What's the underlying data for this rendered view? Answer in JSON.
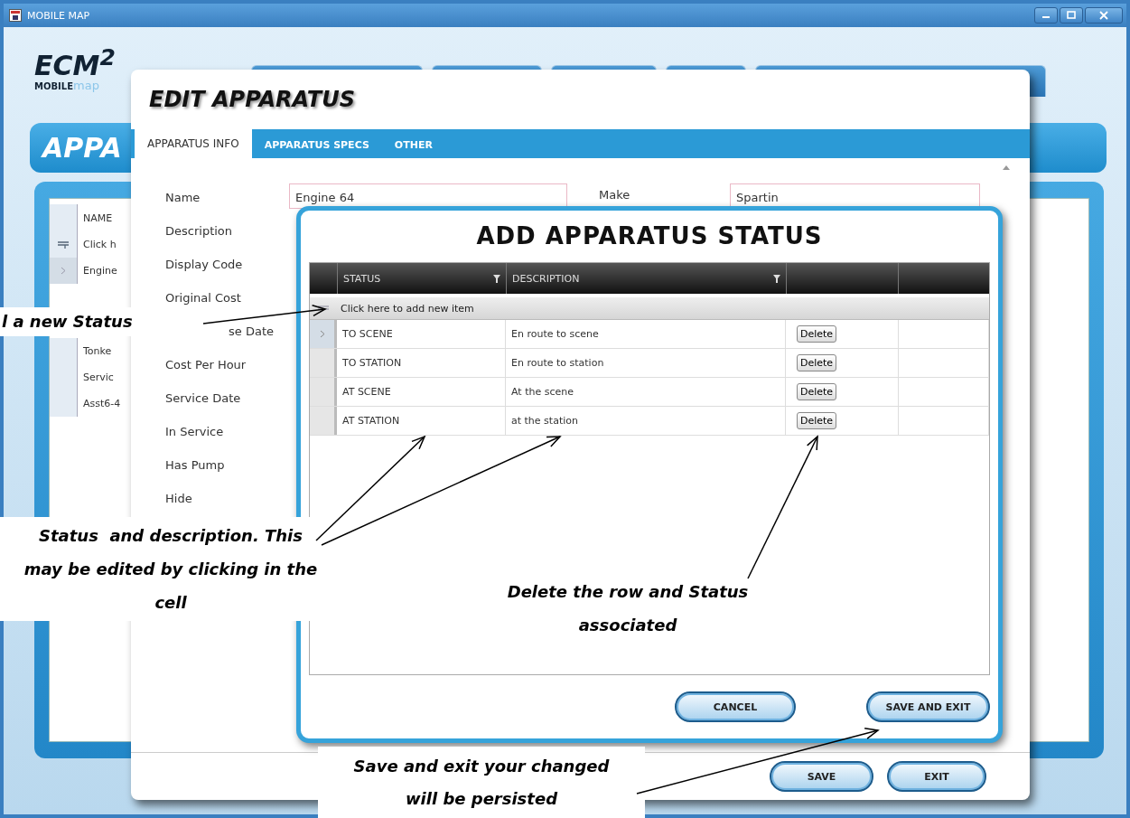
{
  "window": {
    "title": "MOBILE MAP"
  },
  "logo": {
    "title": "ECM$^{2}$",
    "brand": "MOBILE",
    "brand_suffix": "map"
  },
  "app_header": {
    "title": "APPA"
  },
  "background_grid": {
    "column_1": "NAME",
    "new_item": "Click h",
    "rows": [
      {
        "name": "Engine",
        "selected": true
      },
      {
        "name": "Tonke",
        "selected": false
      },
      {
        "name": "Servic",
        "selected": false
      },
      {
        "name": "Asst6-4",
        "selected": false
      }
    ]
  },
  "edit_dialog": {
    "title": "EDIT APPARATUS",
    "tabs": [
      {
        "label": "APPARATUS INFO",
        "selected": true
      },
      {
        "label": "APPARATUS SPECS",
        "selected": false
      },
      {
        "label": "OTHER",
        "selected": false
      }
    ],
    "labels": [
      "Name",
      "Description",
      "Display Code",
      "Original Cost",
      "se Date",
      "Cost Per Hour",
      "Service Date",
      "In Service",
      "Has Pump",
      "Hide"
    ],
    "name_value": "Engine 64",
    "make": {
      "label": "Make",
      "value": "Spartin"
    },
    "buttons": [
      "SAVE",
      "EXIT"
    ]
  },
  "status_dialog": {
    "title": "ADD APPARATUS STATUS",
    "columns": [
      "STATUS",
      "DESCRIPTION"
    ],
    "new_item": "Click here to add new item",
    "rows": [
      {
        "status": "TO SCENE",
        "description": "En route to scene",
        "action": "Delete",
        "selected": true
      },
      {
        "status": "TO STATION",
        "description": "En route to station",
        "action": "Delete",
        "selected": false
      },
      {
        "status": "AT SCENE",
        "description": "At the scene",
        "action": "Delete",
        "selected": false
      },
      {
        "status": "AT STATION",
        "description": "at the station",
        "action": "Delete",
        "selected": false
      }
    ],
    "buttons": [
      "CANCEL",
      "SAVE AND EXIT"
    ]
  },
  "callouts": [
    "l a new Status",
    "Status  and description. This may be edited by clicking in the cell",
    "Delete the row and Status associated",
    "Save and exit your changed will be persisted"
  ]
}
